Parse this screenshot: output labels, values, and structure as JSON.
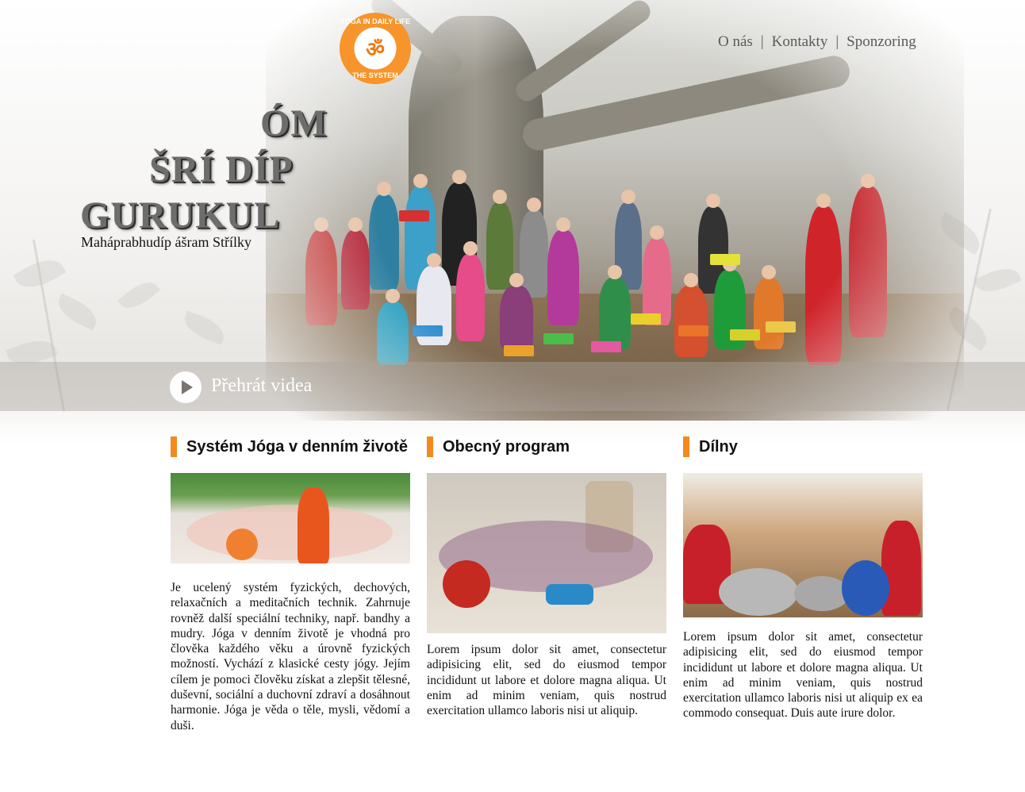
{
  "logo": {
    "ring_top": "YOGA IN DAILY LIFE",
    "ring_bottom": "THE SYSTEM",
    "symbol": "ॐ"
  },
  "nav": {
    "items": [
      "O nás",
      "Kontakty",
      "Sponzoring"
    ],
    "separator": "|"
  },
  "hero": {
    "title_line1": "ÓM",
    "title_line2": "ŠRÍ DÍP",
    "title_line3": "GURUKUL",
    "subtitle": "Maháprabhudíp ášram Střílky",
    "video_label": "Přehrát videa"
  },
  "columns": [
    {
      "heading": "Systém Jóga v denním životě",
      "text": "Je ucelený systém fyzických, dechových, relaxačních a meditačních technik. Zahrnuje rovněž další speciální techniky, např. bandhy a mudry. Jóga v denním životě je vhodná pro člověka každého věku a úrovně fyzických možností. Vychází z klasické cesty jógy. Jejím cílem je pomoci člověku získat a zlepšit tělesné, duševní, sociální a duchovní zdraví a dosáhnout harmonie. Jóga je věda o těle, mysli, vědomí a duši."
    },
    {
      "heading": "Obecný program",
      "text": "Lorem ipsum dolor sit amet, consectetur adipisicing elit, sed do eiusmod tempor incididunt ut labore et dolore magna aliqua. Ut enim ad minim veniam, quis nostrud exercitation ullamco laboris nisi ut aliquip."
    },
    {
      "heading": "Dílny",
      "text": "Lorem ipsum dolor sit amet, consectetur adipisicing elit, sed do eiusmod tempor incididunt ut labore et dolore magna aliqua. Ut enim ad minim veniam, quis nostrud exercitation ullamco laboris nisi ut aliquip ex ea commodo consequat. Duis aute irure dolor."
    }
  ],
  "colors": {
    "accent": "#f28a1e",
    "logo_orange": "#f7942b",
    "text": "#111111",
    "nav": "#5a5a5a"
  }
}
